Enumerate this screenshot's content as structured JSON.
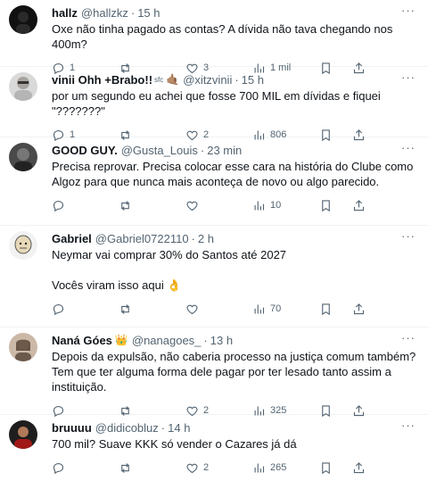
{
  "tweets": [
    {
      "name": "hallz",
      "handle": "@hallzkz",
      "time": "15 h",
      "text": "Oxe não tinha pagado as contas? A dívida não tava chegando nos 400m?",
      "replies": "1",
      "retweets": "",
      "likes": "3",
      "views": "1 mil",
      "avatar_color": "#111111"
    },
    {
      "name": "vinii Ohh +Brabo!!",
      "name_suffix": "sfc",
      "badge_emoji": "🤙🏽",
      "handle": "@xitzvinii",
      "time": "15 h",
      "text": "por um segundo eu achei que fosse 700 MIL em dívidas e fiquei \"???????\"",
      "replies": "1",
      "retweets": "",
      "likes": "2",
      "views": "806",
      "avatar_color": "#c8c8c8"
    },
    {
      "name": "GOOD GUY.",
      "handle": "@Gusta_Louis",
      "time": "23 min",
      "text": "Precisa reprovar. Precisa colocar esse cara na história do Clube como Algoz para que nunca mais aconteça de novo ou algo parecido.",
      "replies": "",
      "retweets": "",
      "likes": "",
      "views": "10",
      "avatar_color": "#3a3a3a"
    },
    {
      "name": "Gabriel",
      "handle": "@Gabriel0722110",
      "time": "2 h",
      "text": "Neymar vai comprar 30% do Santos até 2027\n\nVocês viram isso aqui 👌",
      "replies": "",
      "retweets": "",
      "likes": "",
      "views": "70",
      "avatar_color": "#e9e9e9"
    },
    {
      "name": "Naná Góes",
      "badge_emoji": "👑",
      "handle": "@nanagoes_",
      "time": "13 h",
      "text": "Depois da expulsão, não caberia processo na justiça comum também? Tem que ter alguma forma dele pagar por ter lesado tanto assim a instituição.",
      "replies": "",
      "retweets": "",
      "likes": "2",
      "views": "325",
      "avatar_color": "#8a6f5c"
    },
    {
      "name": "bruuuu",
      "handle": "@didicobluz",
      "time": "14 h",
      "text": "700 mil? Suave KKK só vender o Cazares já dá",
      "replies": "",
      "retweets": "",
      "likes": "2",
      "views": "265",
      "avatar_color": "#7a1f1f"
    }
  ],
  "icons": [
    "more-icon",
    "reply-icon",
    "retweet-icon",
    "like-icon",
    "views-icon",
    "bookmark-icon",
    "share-icon"
  ],
  "colors": {
    "text": "#0f1419",
    "muted": "#536471",
    "divider": "#eff3f4"
  }
}
